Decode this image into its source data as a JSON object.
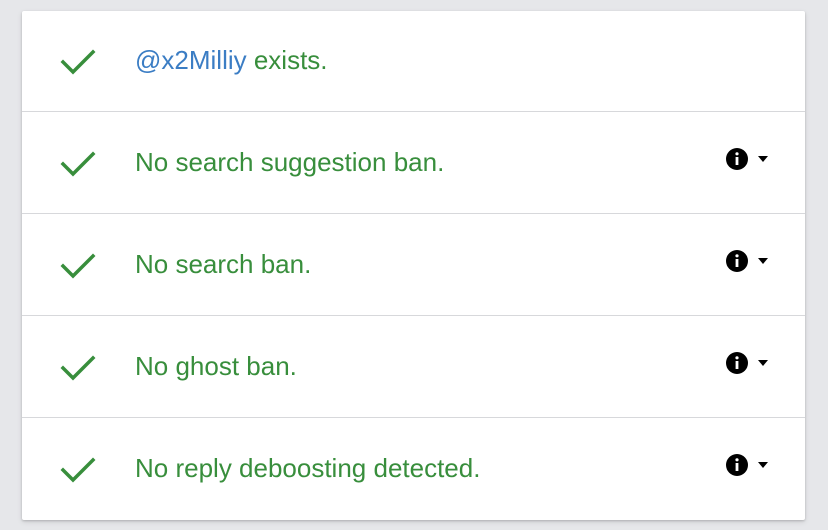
{
  "results": {
    "account": {
      "username": "@x2Milliy",
      "status_text": " exists."
    },
    "checks": [
      {
        "text": "No search suggestion ban.",
        "info_icon": "info-icon",
        "expand_icon": "chevron-down-icon"
      },
      {
        "text": "No search ban.",
        "info_icon": "info-icon",
        "expand_icon": "chevron-down-icon"
      },
      {
        "text": "No ghost ban.",
        "info_icon": "info-icon",
        "expand_icon": "chevron-down-icon"
      },
      {
        "text": "No reply deboosting detected.",
        "info_icon": "info-icon",
        "expand_icon": "chevron-down-icon"
      }
    ]
  },
  "colors": {
    "success_green": "#388e3c",
    "username_blue": "#3b7dc4",
    "background": "#e6e7ea",
    "card": "#ffffff"
  }
}
